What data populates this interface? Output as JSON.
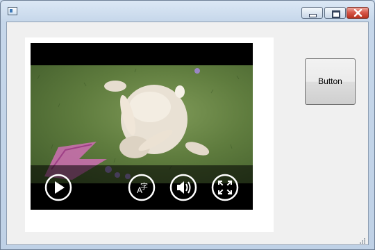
{
  "window": {
    "controls": [
      {
        "name": "minimize",
        "icon": "minimize-icon"
      },
      {
        "name": "maximize",
        "icon": "maximize-icon"
      },
      {
        "name": "close",
        "icon": "close-icon",
        "accent": "#c43c2c"
      }
    ]
  },
  "media": {
    "icons": [
      "play-icon",
      "subtitles-icon",
      "volume-icon",
      "fullscreen-icon"
    ],
    "subtitles_glyph_latin": "A",
    "subtitles_glyph_cjk": "字"
  },
  "side_button": {
    "label": "Button"
  }
}
